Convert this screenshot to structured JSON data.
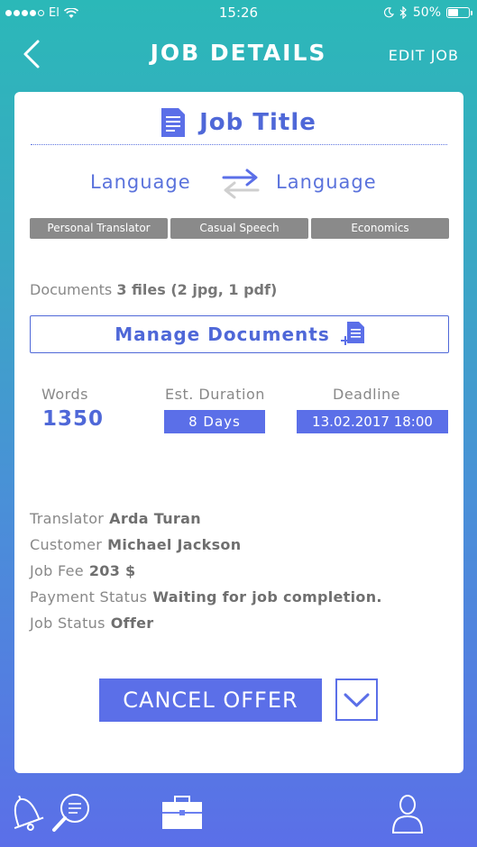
{
  "status_bar": {
    "carrier": "El",
    "time": "15:26",
    "battery_percent": "50%",
    "battery_level": 0.5
  },
  "nav": {
    "title": "JOB DETAILS",
    "edit_label": "EDIT JOB"
  },
  "job": {
    "title": "Job Title",
    "source_language": "Language",
    "target_language": "Language",
    "tags": [
      "Personal Translator",
      "Casual Speech",
      "Economics"
    ],
    "documents_label": "Documents",
    "documents_value": "3 files (2 jpg, 1 pdf)",
    "manage_documents_label": "Manage Documents",
    "words_label": "Words",
    "words_value": "1350",
    "duration_label": "Est. Duration",
    "duration_value": "8 Days",
    "deadline_label": "Deadline",
    "deadline_value": "13.02.2017  18:00",
    "info": [
      {
        "label": "Translator",
        "value": "Arda Turan"
      },
      {
        "label": "Customer",
        "value": "Michael Jackson"
      },
      {
        "label": "Job Fee",
        "value": "203 $"
      },
      {
        "label": "Payment Status",
        "value": "Waiting for job completion."
      },
      {
        "label": "Job Status",
        "value": "Offer"
      }
    ],
    "cancel_label": "CANCEL OFFER"
  },
  "colors": {
    "accent": "#5b6fe8",
    "gradient_top": "#2bb8b8",
    "gradient_bottom": "#5b6fe8",
    "tag_bg": "#8a8a8a"
  },
  "tabs": [
    {
      "icon": "search-icon"
    },
    {
      "icon": "briefcase-icon",
      "active": true
    },
    {
      "icon": "bell-icon"
    },
    {
      "icon": "person-icon"
    }
  ]
}
